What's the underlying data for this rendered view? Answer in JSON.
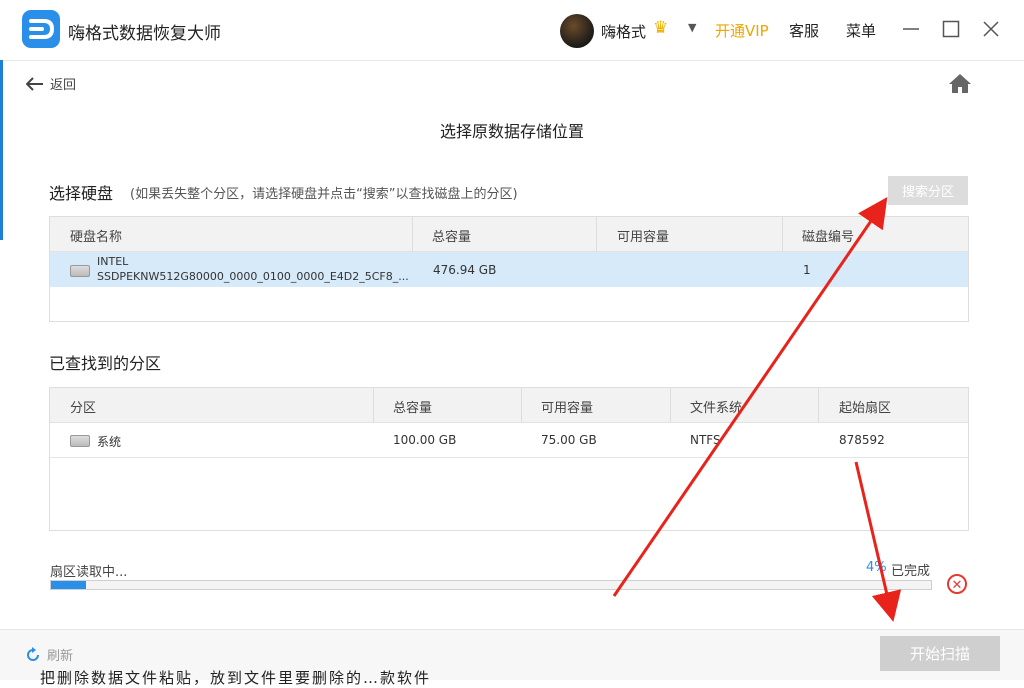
{
  "window": {
    "app_title": "嗨格式数据恢复大师",
    "username": "嗨格式",
    "vip_label": "开通VIP",
    "service_label": "客服",
    "menu_label": "菜单",
    "accent_color": "#2a8fe8",
    "vip_color": "#f0a500",
    "min_icon": "—",
    "max_icon": "☐",
    "close_icon": "✕"
  },
  "nav": {
    "back_label": "返回"
  },
  "page": {
    "title": "选择原数据存储位置"
  },
  "disk_section": {
    "title": "选择硬盘",
    "hint": "(如果丢失整个分区，请选择硬盘并点击“搜索”以查找磁盘上的分区)",
    "search_button": "搜索分区",
    "columns": [
      "硬盘名称",
      "总容量",
      "可用容量",
      "磁盘编号"
    ],
    "rows": [
      {
        "name_line1": "INTEL",
        "name_line2": "SSDPEKNW512G80000_0000_0100_0000_E4D2_5CF8_...",
        "total": "476.94 GB",
        "available": "",
        "disk_no": "1",
        "selected": true
      }
    ]
  },
  "partition_section": {
    "title": "已查找到的分区",
    "columns": [
      "分区",
      "总容量",
      "可用容量",
      "文件系统",
      "起始扇区"
    ],
    "rows": [
      {
        "name": "系统",
        "total": "100.00 GB",
        "available": "75.00 GB",
        "fs": "NTFS",
        "start_sector": "878592"
      }
    ]
  },
  "progress": {
    "label": "扇区读取中...",
    "percent_text": "4%",
    "done_label": "已完成",
    "fraction": 0.04
  },
  "footer": {
    "refresh_label": "刷新",
    "start_button": "开始扫描"
  },
  "background_text": "把删除数据文件粘贴，放到文件里要删除的…款软件"
}
